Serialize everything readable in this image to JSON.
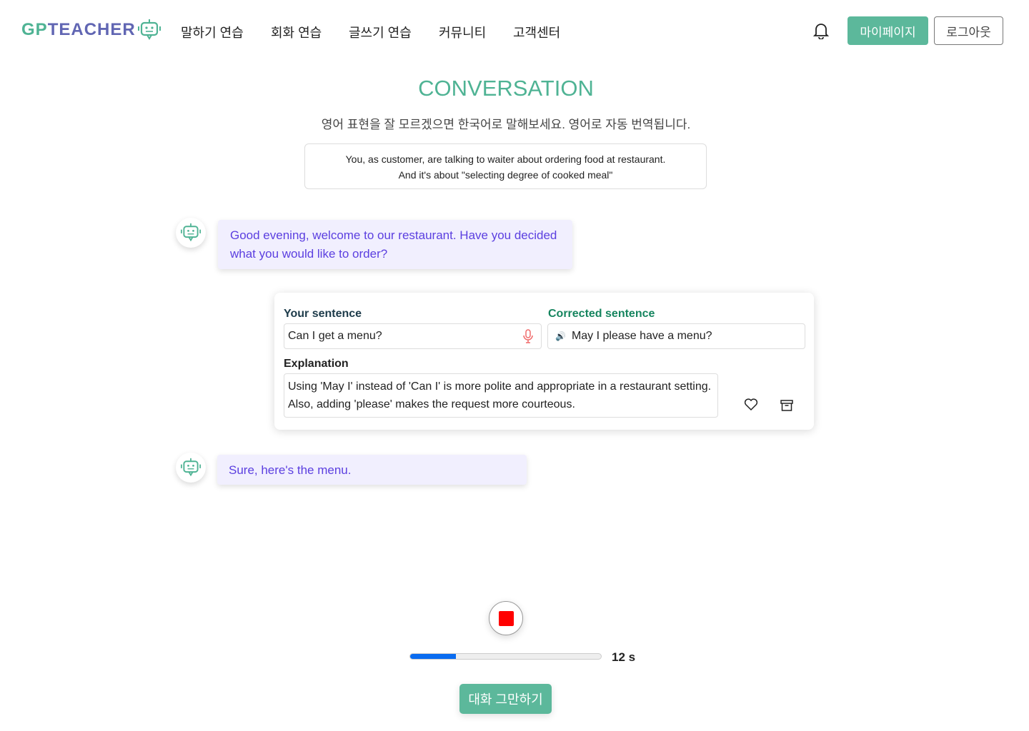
{
  "header": {
    "logo_left": "GP",
    "logo_right": "TEACHER",
    "nav": [
      "말하기 연습",
      "회화 연습",
      "글쓰기 연습",
      "커뮤니티",
      "고객센터"
    ],
    "mypage": "마이페이지",
    "logout": "로그아웃"
  },
  "main": {
    "title": "CONVERSATION",
    "subtitle": "영어 표현을 잘 모르겠으면 한국어로 말해보세요. 영어로 자동 번역됩니다.",
    "scenario_line1": "You, as customer, are talking to waiter about ordering food at restaurant.",
    "scenario_line2": "And it's about \"selecting degree of cooked meal\""
  },
  "messages": [
    {
      "text": "Good evening, welcome to our restaurant. Have you decided what you would like to order?"
    },
    {
      "text": "Sure, here's the menu."
    }
  ],
  "feedback": {
    "your_label": "Your sentence",
    "your_value": "Can I get a menu?",
    "corrected_label": "Corrected sentence",
    "corrected_value": "May I please have a menu?",
    "explanation_label": "Explanation",
    "explanation": "Using 'May I' instead of 'Can I' is more polite and appropriate in a restaurant setting. Also, adding 'please' makes the request more courteous."
  },
  "recorder": {
    "progress_percent": 24,
    "seconds": "12 s",
    "stop_label": "대화 그만하기"
  },
  "colors": {
    "accent": "#5cb89b",
    "bubble_text": "#5b3fe0",
    "progress": "#0a6cf0"
  }
}
